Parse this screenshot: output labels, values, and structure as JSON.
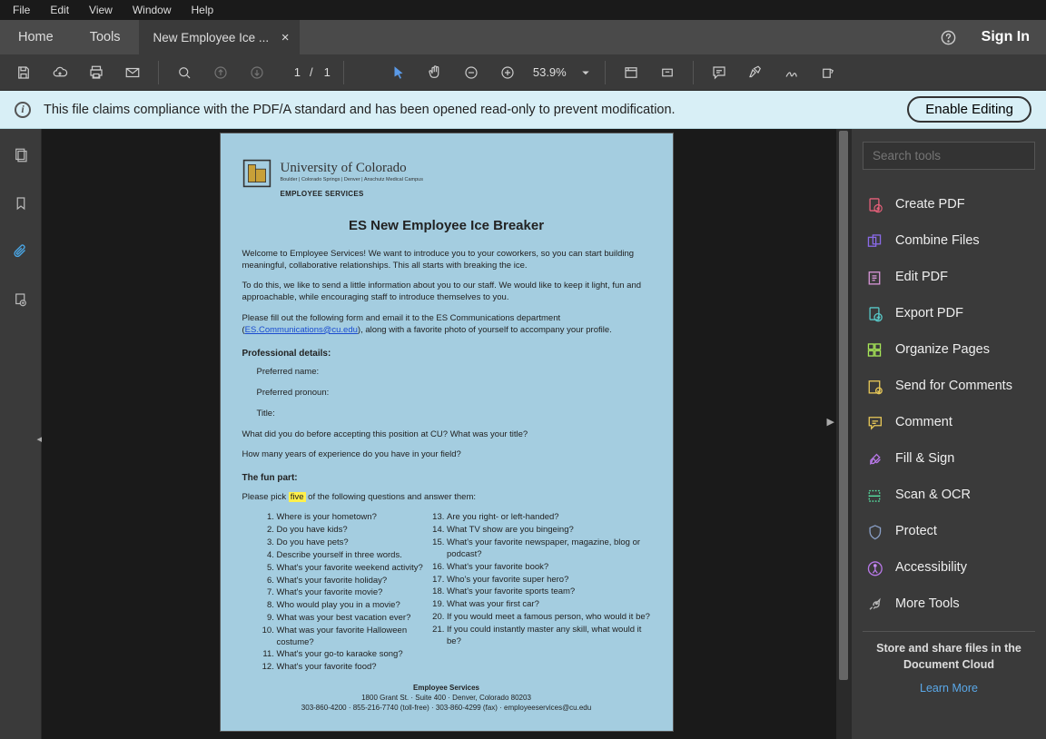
{
  "menu": {
    "file": "File",
    "edit": "Edit",
    "view": "View",
    "window": "Window",
    "help": "Help"
  },
  "tabs": {
    "home": "Home",
    "tools": "Tools",
    "doc": "New Employee Ice ...",
    "signin": "Sign In"
  },
  "toolbar": {
    "page_cur": "1",
    "page_sep": "/",
    "page_total": "1",
    "zoom": "53.9%"
  },
  "banner": {
    "text": "This file claims compliance with the PDF/A standard and has been opened read-only to prevent modification.",
    "button": "Enable Editing"
  },
  "rightpanel": {
    "search_placeholder": "Search tools",
    "items": [
      "Create PDF",
      "Combine Files",
      "Edit PDF",
      "Export PDF",
      "Organize Pages",
      "Send for Comments",
      "Comment",
      "Fill & Sign",
      "Scan & OCR",
      "Protect",
      "Accessibility",
      "More Tools"
    ],
    "promo1": "Store and share files in the",
    "promo2": "Document Cloud",
    "link": "Learn More"
  },
  "doc": {
    "uni": "University of Colorado",
    "uni_sub": "Boulder | Colorado Springs | Denver | Anschutz Medical Campus",
    "emp_sv": "EMPLOYEE SERVICES",
    "title": "ES New Employee Ice Breaker",
    "p1": "Welcome to Employee Services! We want to introduce you to your coworkers, so you can start building meaningful, collaborative relationships. This all starts with breaking the ice.",
    "p2": "To do this, we like to send a little information about you to our staff. We would like to keep it light, fun and approachable, while encouraging staff to introduce themselves to you.",
    "p3a": "Please fill out the following form and email it to the ES Communications department (",
    "p3_link": "ES.Communications@cu.edu",
    "p3b": "), along with a favorite photo of yourself to accompany your profile.",
    "prof_h": "Professional details:",
    "f1": "Preferred name:",
    "f2": "Preferred pronoun:",
    "f3": "Title:",
    "q_prev": "What did you do before accepting this position at CU? What was your title?",
    "q_exp": "How many years of experience do you have in your field?",
    "fun_h": "The fun part:",
    "pick_a": "Please pick ",
    "pick_hl": "five",
    "pick_b": " of the following questions and answer them:",
    "ql": [
      "Where is your hometown?",
      "Do you have kids?",
      "Do you have pets?",
      "Describe yourself in three words.",
      "What's your favorite weekend activity?",
      "What's your favorite holiday?",
      "What's your favorite movie?",
      "Who would play you in a movie?",
      "What was your best vacation ever?",
      "What was your favorite Halloween costume?",
      "What's your go-to karaoke song?",
      "What's your favorite food?"
    ],
    "qr": [
      "Are you right- or left-handed?",
      "What TV show are you bingeing?",
      "What's your favorite newspaper, magazine, blog or podcast?",
      "What's your favorite book?",
      "Who's your favorite super hero?",
      "What's your favorite sports team?",
      "What was your first car?",
      "If you would meet a famous person, who would it be?",
      "If you could instantly master any skill, what would it be?"
    ],
    "foot_top": "Employee Services",
    "foot_addr": "1800 Grant St.  ·  Suite 400  ·  Denver, Colorado 80203",
    "foot_ph": "303-860-4200  ·  855-216-7740 (toll-free)  ·  303-860-4299 (fax)  ·  employeeservices@cu.edu"
  },
  "icon_colors": {
    "create": "#e8607a",
    "combine": "#8a6ae8",
    "edit": "#d896d8",
    "export": "#58c8c8",
    "organize": "#a8e858",
    "send": "#e8c858",
    "comment": "#e8c858",
    "fill": "#b878e8",
    "scan": "#58e8a8",
    "protect": "#8aa0c8",
    "access": "#b878e8",
    "more": "#bbb"
  }
}
